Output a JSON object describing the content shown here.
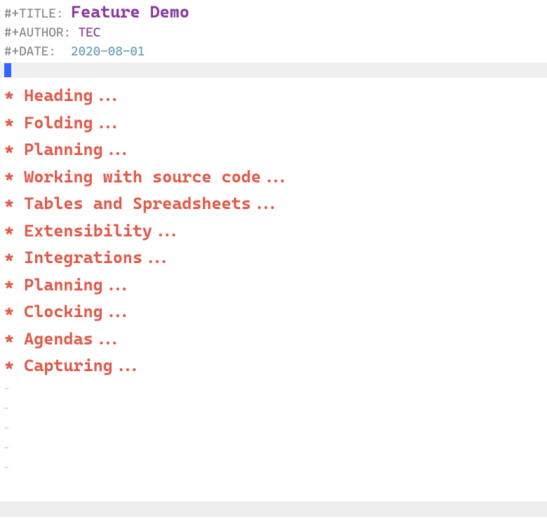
{
  "meta": {
    "title_keyword": "#+TITLE:",
    "title_value": "Feature Demo",
    "author_keyword": "#+AUTHOR:",
    "author_value": "TEC",
    "date_keyword": "#+DATE:",
    "date_value": "2020-08-01"
  },
  "headings": [
    {
      "star": "* ",
      "text": "Heading..."
    },
    {
      "star": "* ",
      "text": "Folding..."
    },
    {
      "star": "* ",
      "text": "Planning..."
    },
    {
      "star": "* ",
      "text": "Working with source code..."
    },
    {
      "star": "* ",
      "text": "Tables and Spreadsheets..."
    },
    {
      "star": "* ",
      "text": "Extensibility..."
    },
    {
      "star": "* ",
      "text": "Integrations..."
    },
    {
      "star": "* ",
      "text": "Planning..."
    },
    {
      "star": "* ",
      "text": "Clocking..."
    },
    {
      "star": "* ",
      "text": "Agendas..."
    },
    {
      "star": "* ",
      "text": "Capturing..."
    }
  ],
  "tildes": [
    "~",
    "~",
    "~",
    "~",
    "~"
  ]
}
